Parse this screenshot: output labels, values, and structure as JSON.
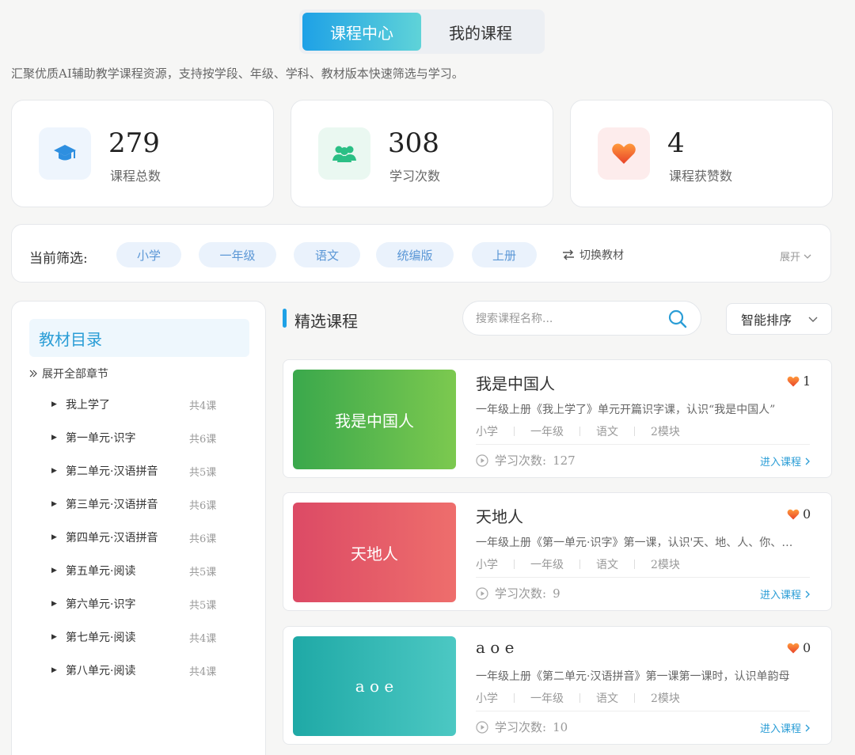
{
  "tabs": [
    {
      "label": "课程中心",
      "active": true
    },
    {
      "label": "我的课程",
      "active": false
    }
  ],
  "subtitle": "汇聚优质AI辅助教学课程资源，支持按学段、年级、学科、教材版本快速筛选与学习。",
  "stats": [
    {
      "value": "279",
      "label": "课程总数",
      "icon": "graduation-cap-icon",
      "color": "#2e8fe0"
    },
    {
      "value": "308",
      "label": "学习次数",
      "icon": "users-icon",
      "color": "#2bbf85"
    },
    {
      "value": "4",
      "label": "课程获赞数",
      "icon": "heart-icon",
      "color": "#f0672a"
    }
  ],
  "filter": {
    "label": "当前筛选:",
    "chips": [
      "小学",
      "一年级",
      "语文",
      "统编版",
      "上册"
    ],
    "switch_label": "切换教材",
    "expand_label": "展开"
  },
  "sidebar": {
    "title": "教材目录",
    "expand_all": "展开全部章节",
    "chapters": [
      {
        "name": "我上学了",
        "count": "共4课"
      },
      {
        "name": "第一单元·识字",
        "count": "共6课"
      },
      {
        "name": "第二单元·汉语拼音",
        "count": "共5课"
      },
      {
        "name": "第三单元·汉语拼音",
        "count": "共6课"
      },
      {
        "name": "第四单元·汉语拼音",
        "count": "共6课"
      },
      {
        "name": "第五单元·阅读",
        "count": "共5课"
      },
      {
        "name": "第六单元·识字",
        "count": "共5课"
      },
      {
        "name": "第七单元·阅读",
        "count": "共4课"
      },
      {
        "name": "第八单元·阅读",
        "count": "共4课"
      }
    ]
  },
  "featured": {
    "title": "精选课程",
    "search_placeholder": "搜索课程名称...",
    "sort_label": "智能排序"
  },
  "courses": [
    {
      "title": "我是中国人",
      "thumb_text": "我是中国人",
      "likes": "1",
      "desc": "一年级上册《我上学了》单元开篇识字课，认识“我是中国人”",
      "tags": [
        "小学",
        "一年级",
        "语文",
        "2模块"
      ],
      "views_label": "学习次数:",
      "views": "127",
      "enter_label": "进入课程",
      "gradient": [
        "#3aa84c",
        "#7cc94f"
      ]
    },
    {
      "title": "天地人",
      "thumb_text": "天地人",
      "likes": "0",
      "desc": "一年级上册《第一单元·识字》第一课，认识'天、地、人、你、我、他'",
      "tags": [
        "小学",
        "一年级",
        "语文",
        "2模块"
      ],
      "views_label": "学习次数:",
      "views": "9",
      "enter_label": "进入课程",
      "gradient": [
        "#dc4a65",
        "#ee6e6c"
      ]
    },
    {
      "title": "a o e",
      "thumb_text": "a o e",
      "likes": "0",
      "desc": "一年级上册《第二单元·汉语拼音》第一课第一课时，认识单韵母",
      "tags": [
        "小学",
        "一年级",
        "语文",
        "2模块"
      ],
      "views_label": "学习次数:",
      "views": "10",
      "enter_label": "进入课程",
      "gradient": [
        "#1fa9a6",
        "#4cc8c3"
      ]
    }
  ]
}
